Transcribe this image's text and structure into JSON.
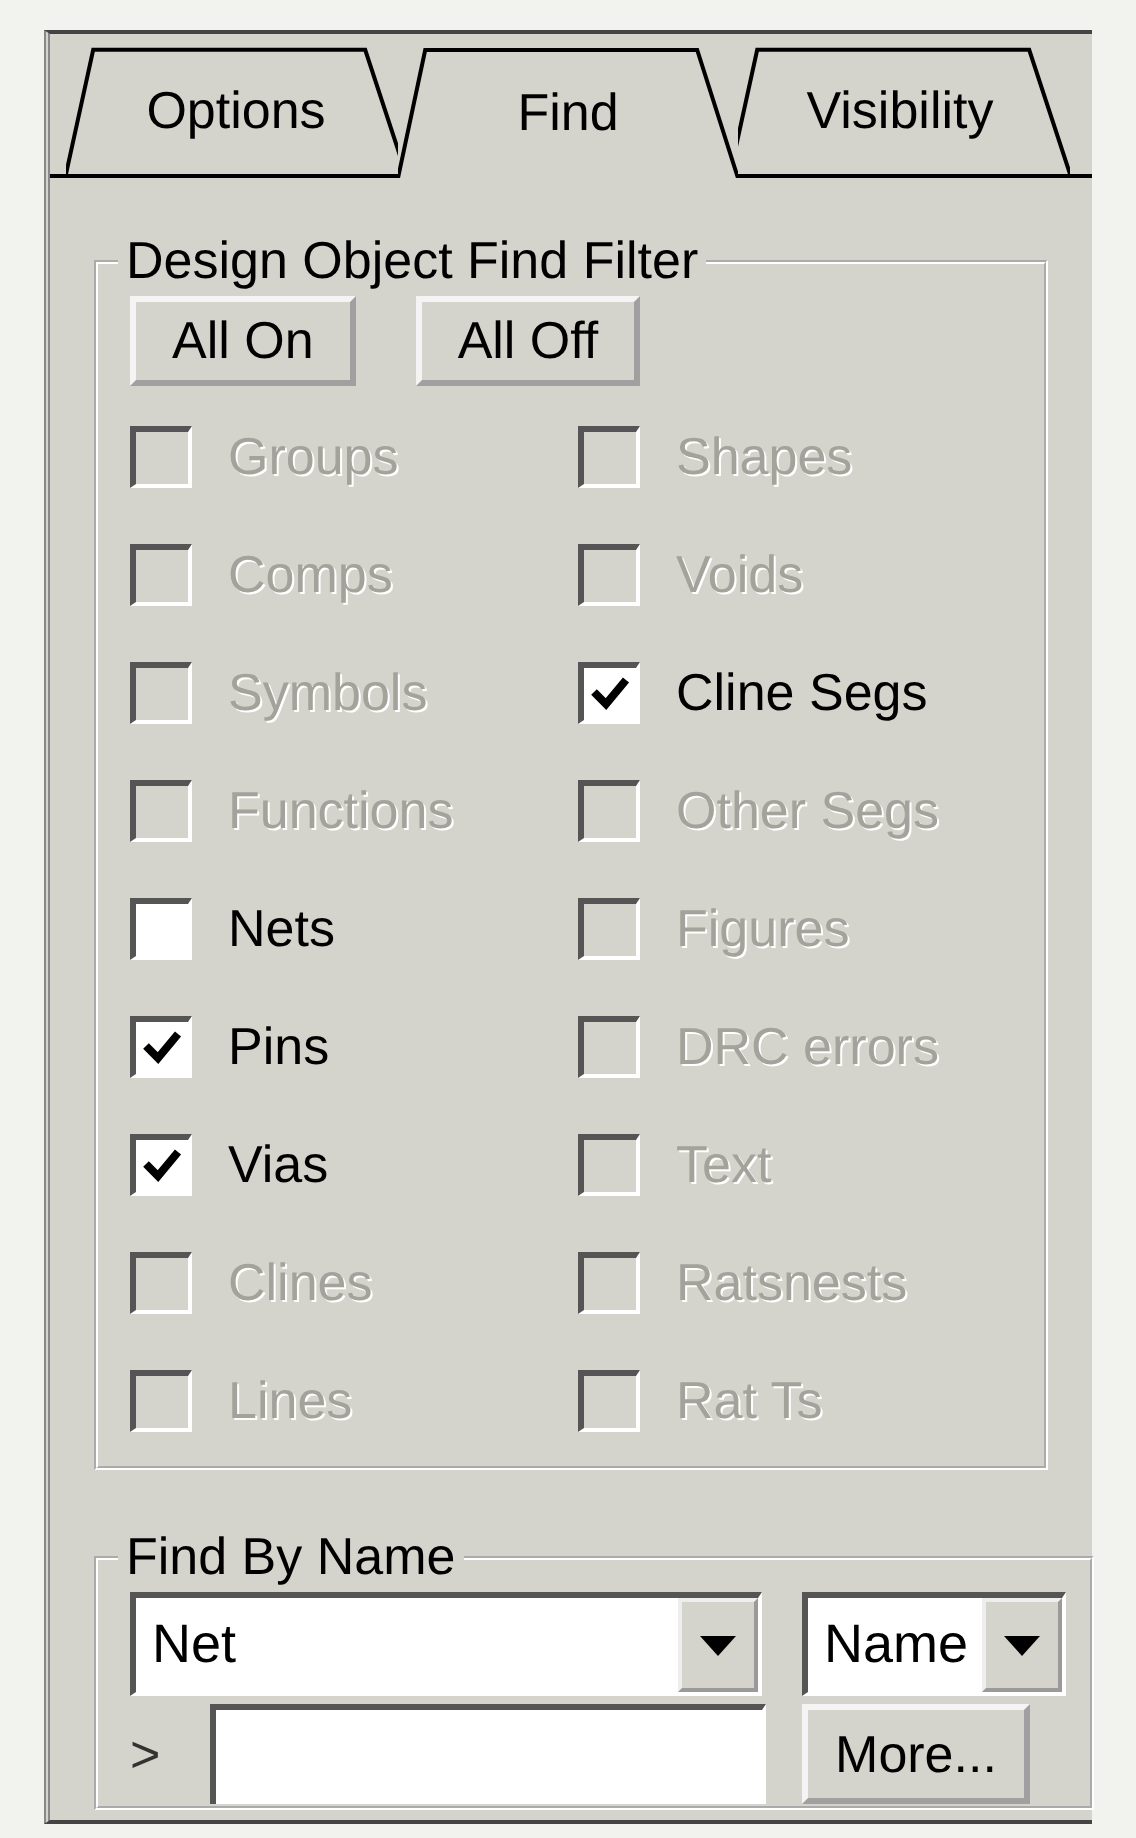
{
  "tabs": [
    {
      "label": "Options",
      "selected": false
    },
    {
      "label": "Find",
      "selected": true
    },
    {
      "label": "Visibility",
      "selected": false
    }
  ],
  "filter_group": {
    "title": "Design Object Find Filter",
    "buttons": [
      "All On",
      "All Off"
    ],
    "checkboxes": [
      {
        "label": "Groups",
        "checked": false,
        "disabled": true
      },
      {
        "label": "Shapes",
        "checked": false,
        "disabled": true
      },
      {
        "label": "Comps",
        "checked": false,
        "disabled": true
      },
      {
        "label": "Voids",
        "checked": false,
        "disabled": true
      },
      {
        "label": "Symbols",
        "checked": false,
        "disabled": true
      },
      {
        "label": "Cline Segs",
        "checked": true,
        "disabled": false
      },
      {
        "label": "Functions",
        "checked": false,
        "disabled": true
      },
      {
        "label": "Other Segs",
        "checked": false,
        "disabled": true
      },
      {
        "label": "Nets",
        "checked": false,
        "disabled": false
      },
      {
        "label": "Figures",
        "checked": false,
        "disabled": true
      },
      {
        "label": "Pins",
        "checked": true,
        "disabled": false
      },
      {
        "label": "DRC errors",
        "checked": false,
        "disabled": true
      },
      {
        "label": "Vias",
        "checked": true,
        "disabled": false
      },
      {
        "label": "Text",
        "checked": false,
        "disabled": true
      },
      {
        "label": "Clines",
        "checked": false,
        "disabled": true
      },
      {
        "label": "Ratsnests",
        "checked": false,
        "disabled": true
      },
      {
        "label": "Lines",
        "checked": false,
        "disabled": true
      },
      {
        "label": "Rat Ts",
        "checked": false,
        "disabled": true
      }
    ]
  },
  "find_by_name": {
    "title": "Find By Name",
    "object_type": {
      "value": "Net"
    },
    "match_by": {
      "value": "Name"
    },
    "prompt": ">",
    "more_button": "More..."
  }
}
